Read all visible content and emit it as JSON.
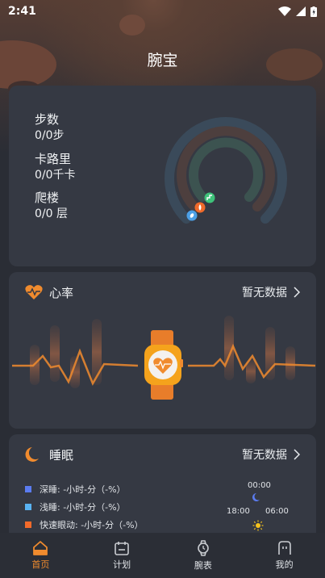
{
  "status_bar": {
    "time": "2:41"
  },
  "page_title": "腕宝",
  "activity": {
    "steps_label": "步数",
    "steps_value": "0/0步",
    "calories_label": "卡路里",
    "calories_value": "0/0千卡",
    "floors_label": "爬楼",
    "floors_value": "0/0 层",
    "ring_colors": {
      "outer": "#3a4a5a",
      "middle": "#4a3f3e",
      "inner": "#3c5350"
    }
  },
  "heart_rate": {
    "title": "心率",
    "status": "暂无数据"
  },
  "sleep": {
    "title": "睡眠",
    "status": "暂无数据",
    "legend": [
      {
        "label": "深睡: -小时-分（-%）",
        "color": "#5b7cf0"
      },
      {
        "label": "浅睡: -小时-分（-%）",
        "color": "#59b3f2"
      },
      {
        "label": "快速眼动: -小时-分（-%）",
        "color": "#f26a2a"
      }
    ],
    "clock": {
      "top": "00:00",
      "left": "18:00",
      "right": "06:00"
    }
  },
  "tabs": [
    {
      "label": "首页",
      "icon": "home-icon",
      "active": true
    },
    {
      "label": "计划",
      "icon": "calendar-icon",
      "active": false
    },
    {
      "label": "腕表",
      "icon": "watch-icon",
      "active": false
    },
    {
      "label": "我的",
      "icon": "profile-icon",
      "active": false
    }
  ],
  "colors": {
    "accent": "#f08b2e",
    "card": "#353943",
    "background": "#2a2d35"
  }
}
